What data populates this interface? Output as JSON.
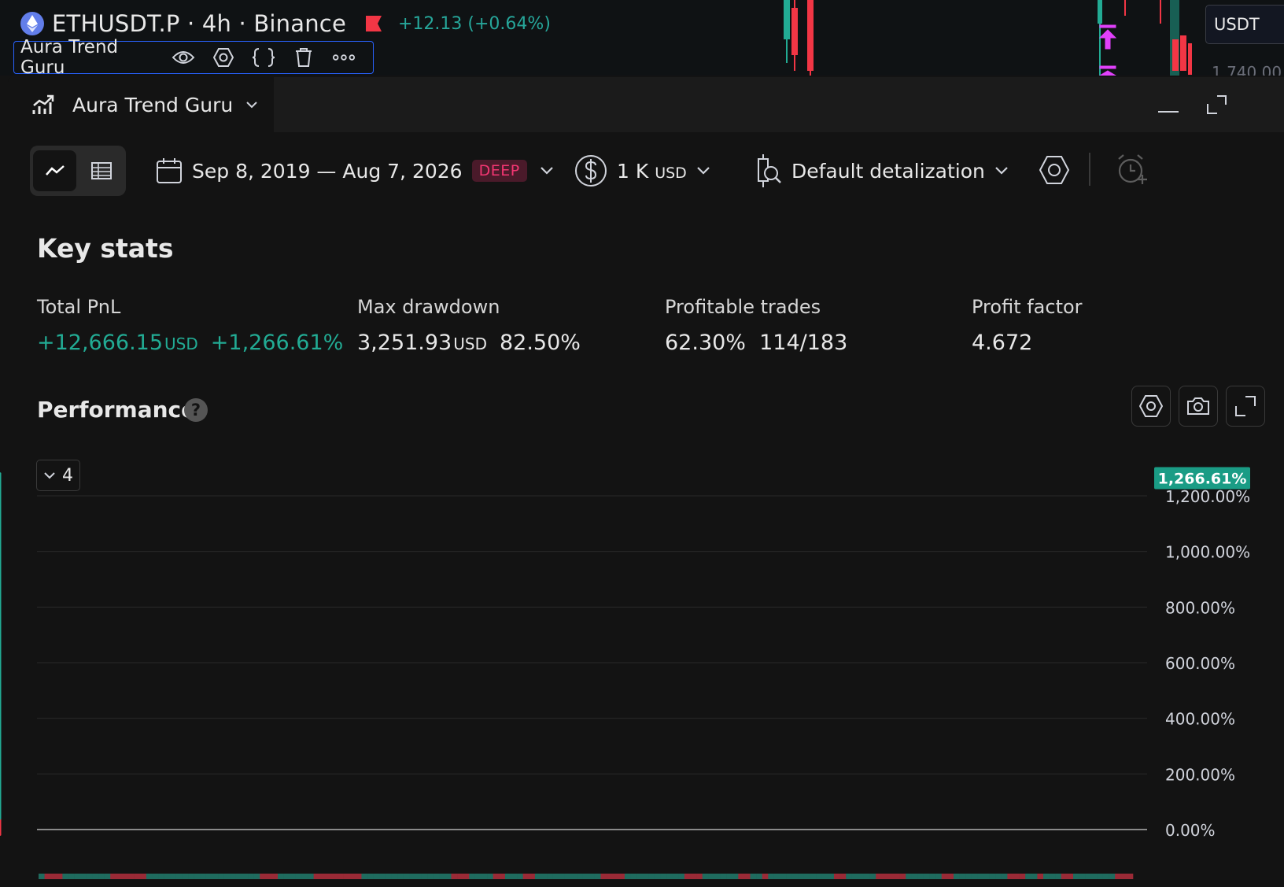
{
  "header": {
    "symbol_title": "ETHUSDT.P · 4h · Binance",
    "change": "+12.13 (+0.64%)",
    "indicator_name": "Aura Trend Guru",
    "currency_selector": "USDT",
    "background_price": "1,740.00"
  },
  "panel": {
    "tab_title": "Aura Trend Guru"
  },
  "toolbar": {
    "date_range": "Sep 8, 2019 — Aug 7, 2026",
    "deep_badge": "DEEP",
    "capital": "1 K",
    "capital_unit": "USD",
    "detalization": "Default detalization"
  },
  "key_stats": {
    "title": "Key stats",
    "total_pnl": {
      "label": "Total PnL",
      "value": "+12,666.15",
      "unit": "USD",
      "percent": "+1,266.61%"
    },
    "max_drawdown": {
      "label": "Max drawdown",
      "value": "3,251.93",
      "unit": "USD",
      "percent": "82.50%"
    },
    "profitable_trades": {
      "label": "Profitable trades",
      "percent": "62.30%",
      "ratio": "114/183"
    },
    "profit_factor": {
      "label": "Profit factor",
      "value": "4.672"
    }
  },
  "performance": {
    "title": "Performance",
    "help": "?",
    "collapse_count": "4"
  },
  "colors": {
    "accent_green": "#22ab94",
    "loss_red": "#f23645",
    "deep_pink": "#f23672",
    "panel_bg": "#131313"
  },
  "chart_data": {
    "type": "area",
    "x": [
      0,
      1,
      2,
      3,
      4,
      5,
      6,
      7,
      8,
      9,
      10,
      11,
      12,
      13,
      14,
      15,
      16,
      17,
      18,
      19,
      20,
      21,
      22,
      23,
      24,
      25,
      26,
      27,
      28,
      29,
      30,
      31,
      32,
      33,
      34,
      35,
      36,
      37,
      38,
      39,
      40,
      41,
      42,
      43,
      44,
      45,
      46,
      47,
      48,
      49,
      50,
      51,
      52,
      53,
      54,
      55,
      56,
      57,
      58,
      59,
      60,
      61,
      62,
      63,
      64,
      65,
      66,
      67,
      68,
      69,
      70,
      71,
      72,
      73,
      74,
      75,
      76,
      77,
      78,
      79,
      80,
      81,
      82,
      83,
      84,
      85,
      86,
      87,
      88,
      89,
      90,
      91,
      92,
      93,
      94,
      95,
      96,
      97,
      98,
      99,
      100,
      101,
      102,
      103,
      104,
      105,
      106,
      107,
      108,
      109,
      110,
      111,
      112,
      113,
      114,
      115,
      116,
      117,
      118,
      119,
      120,
      121,
      122,
      123,
      124,
      125,
      126,
      127,
      128,
      129,
      130,
      131,
      132,
      133,
      134,
      135,
      136,
      137,
      138,
      139,
      140,
      141,
      142,
      143,
      144,
      145,
      146,
      147,
      148,
      149,
      150,
      151,
      152,
      153,
      154,
      155,
      156,
      157,
      158,
      159,
      160,
      161,
      162,
      163,
      164,
      165,
      166,
      167,
      168,
      169,
      170,
      171,
      172,
      173,
      174,
      175,
      176,
      177,
      178,
      179,
      180,
      181,
      182
    ],
    "values": [
      12,
      70,
      88,
      145,
      100,
      50,
      8,
      -18,
      -5,
      60,
      70,
      115,
      125,
      115,
      118,
      160,
      175,
      150,
      175,
      170,
      180,
      220,
      230,
      275,
      290,
      325,
      370,
      340,
      315,
      295,
      260,
      230,
      200,
      165,
      140,
      145,
      215,
      180,
      135,
      100,
      70,
      40,
      55,
      105,
      135,
      160,
      210,
      220,
      265,
      285,
      255,
      265,
      310,
      325,
      345,
      360,
      375,
      380,
      410,
      445,
      495,
      505,
      555,
      520,
      495,
      505,
      475,
      485,
      525,
      535,
      575,
      610,
      575,
      590,
      650,
      675,
      725,
      700,
      675,
      680,
      710,
      740,
      745,
      725,
      735,
      710,
      690,
      670,
      650,
      635,
      650,
      670,
      650,
      635,
      645,
      685,
      700,
      695,
      705,
      705,
      715,
      745,
      760,
      750,
      760,
      755,
      770,
      760,
      785,
      800,
      825,
      850,
      830,
      810,
      790,
      775,
      790,
      835,
      800,
      765,
      780,
      790,
      775,
      760,
      745,
      735,
      710,
      720,
      760,
      740,
      725,
      735,
      760,
      795,
      825,
      800,
      785,
      790,
      770,
      755,
      740,
      750,
      790,
      815,
      800,
      815,
      830,
      840,
      880,
      900,
      950,
      985,
      1020,
      1060,
      1080,
      1120,
      1070,
      1030,
      1035,
      1080,
      1095,
      1120,
      1100,
      1090,
      1100,
      1150,
      1170,
      1215,
      1230,
      1220,
      1200,
      1180,
      1160,
      1190,
      1230,
      1240,
      1220,
      1215,
      1200,
      1230,
      1260,
      1280,
      1265,
      1240,
      1265,
      1250,
      1266.61
    ],
    "y_ticks": [
      "0.00%",
      "200.00%",
      "400.00%",
      "600.00%",
      "800.00%",
      "1,000.00%",
      "1,200.00%"
    ],
    "y_tick_values": [
      0,
      200,
      400,
      600,
      800,
      1000,
      1200
    ],
    "last_label": "1,266.61%",
    "ylim": [
      0,
      1266.61
    ],
    "grid": true,
    "trade_bar": [
      1,
      0,
      0,
      0,
      1,
      1,
      1,
      1,
      1,
      1,
      1,
      1,
      0,
      0,
      0,
      0,
      0,
      0,
      1,
      1,
      1,
      1,
      1,
      1,
      1,
      1,
      1,
      1,
      1,
      1,
      1,
      1,
      1,
      1,
      1,
      1,
      1,
      0,
      0,
      0,
      1,
      1,
      1,
      1,
      1,
      1,
      0,
      0,
      0,
      0,
      0,
      0,
      0,
      0,
      1,
      1,
      1,
      1,
      1,
      1,
      1,
      1,
      1,
      1,
      1,
      1,
      1,
      1,
      1,
      0,
      0,
      0,
      1,
      1,
      1,
      1,
      0,
      0,
      1,
      1,
      1,
      0,
      0,
      1,
      1,
      1,
      1,
      1,
      1,
      1,
      1,
      1,
      1,
      1,
      0,
      0,
      0,
      0,
      1,
      1,
      1,
      1,
      1,
      1,
      1,
      1,
      1,
      1,
      0,
      0,
      0,
      1,
      1,
      1,
      1,
      1,
      1,
      0,
      0,
      1,
      1,
      0,
      1,
      1,
      1,
      1,
      1,
      1,
      1,
      1,
      1,
      1,
      1,
      0,
      0,
      1,
      1,
      1,
      1,
      1,
      0,
      0,
      0,
      0,
      0,
      1,
      1,
      1,
      1,
      1,
      1,
      0,
      0,
      1,
      1,
      1,
      1,
      1,
      1,
      1,
      1,
      1,
      0,
      0,
      0,
      1,
      1,
      0,
      1,
      1,
      1,
      0,
      0,
      1,
      1,
      1,
      1,
      1,
      1,
      1,
      0,
      0,
      0
    ]
  }
}
